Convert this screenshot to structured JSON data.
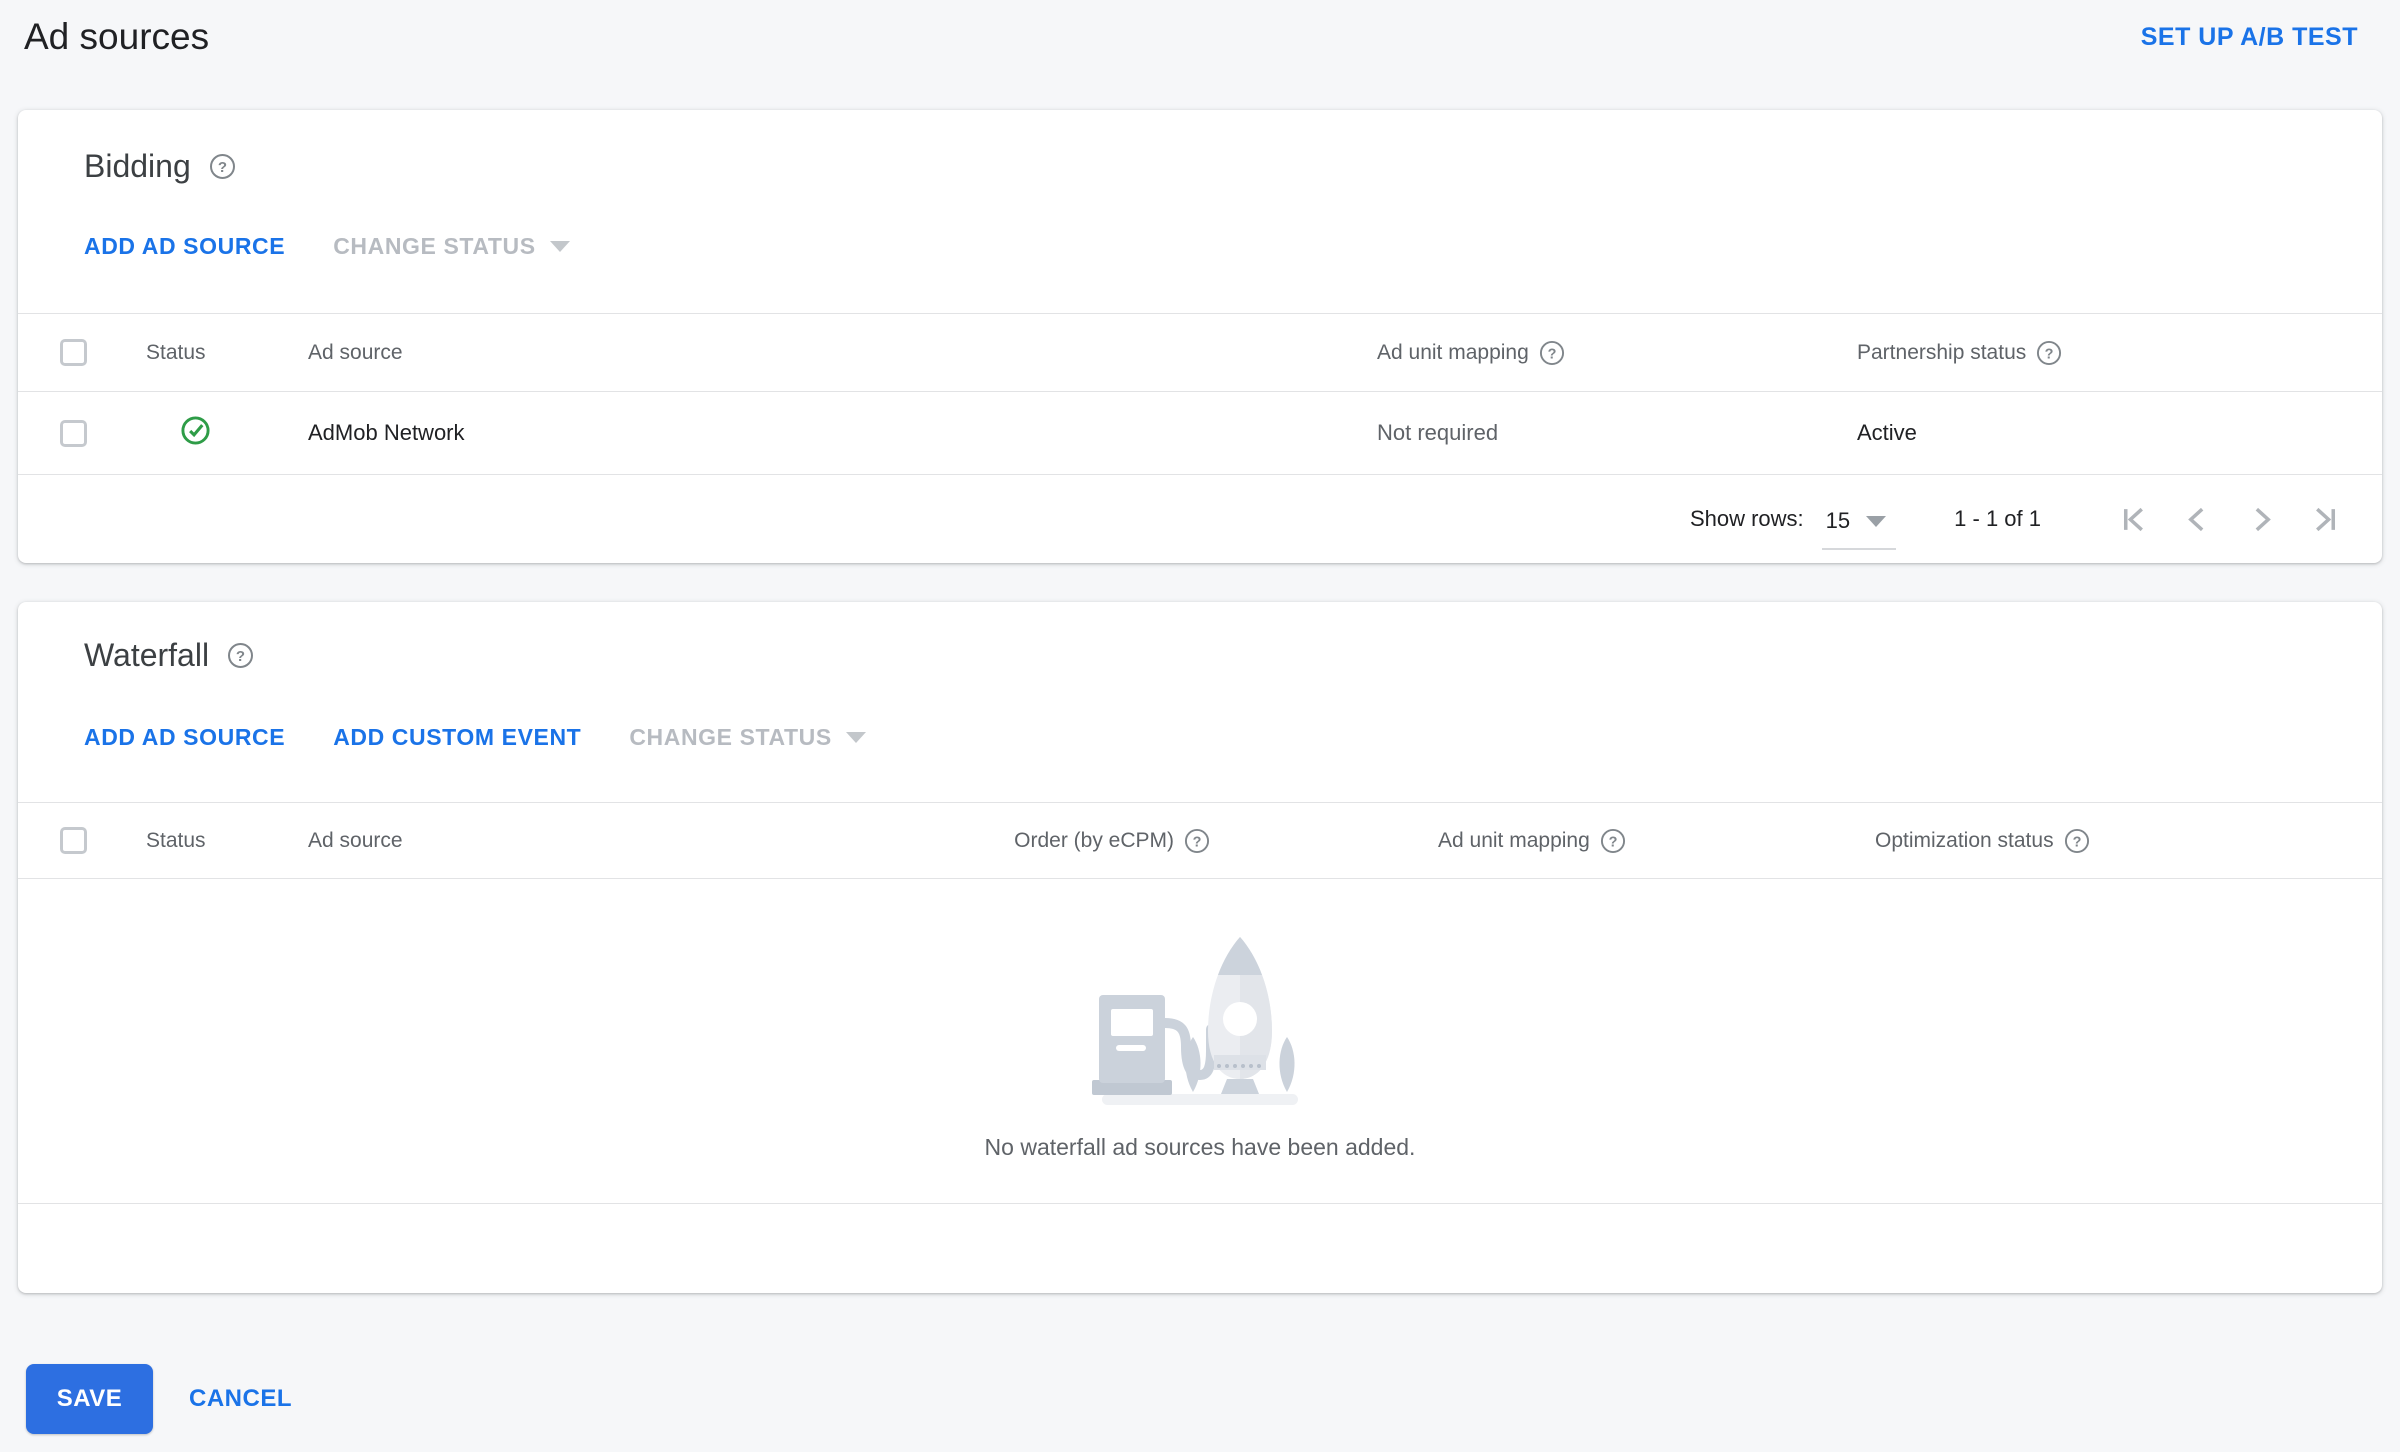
{
  "page": {
    "title": "Ad sources",
    "setup_ab_test": "SET UP A/B TEST"
  },
  "icons": {
    "help_glyph": "?"
  },
  "colors": {
    "accent_blue": "#1a73e8",
    "save_button_blue": "#2d6fe1",
    "status_active_green": "#2e9c47",
    "disabled_gray": "#b7bbc1"
  },
  "bidding": {
    "title": "Bidding",
    "actions": {
      "add_ad_source": "ADD AD SOURCE",
      "change_status": "CHANGE STATUS"
    },
    "columns": {
      "status": "Status",
      "ad_source": "Ad source",
      "ad_unit_mapping": "Ad unit mapping",
      "partnership_status": "Partnership status"
    },
    "rows": [
      {
        "status": "active",
        "ad_source": "AdMob Network",
        "ad_unit_mapping": "Not required",
        "partnership_status": "Active"
      }
    ],
    "pagination": {
      "show_rows_label": "Show rows:",
      "rows_per_page": "15",
      "range": "1 - 1 of 1"
    }
  },
  "waterfall": {
    "title": "Waterfall",
    "actions": {
      "add_ad_source": "ADD AD SOURCE",
      "add_custom_event": "ADD CUSTOM EVENT",
      "change_status": "CHANGE STATUS"
    },
    "columns": {
      "status": "Status",
      "ad_source": "Ad source",
      "order": "Order (by eCPM)",
      "ad_unit_mapping": "Ad unit mapping",
      "optimization_status": "Optimization status"
    },
    "empty_message": "No waterfall ad sources have been added."
  },
  "footer": {
    "save": "SAVE",
    "cancel": "CANCEL"
  }
}
